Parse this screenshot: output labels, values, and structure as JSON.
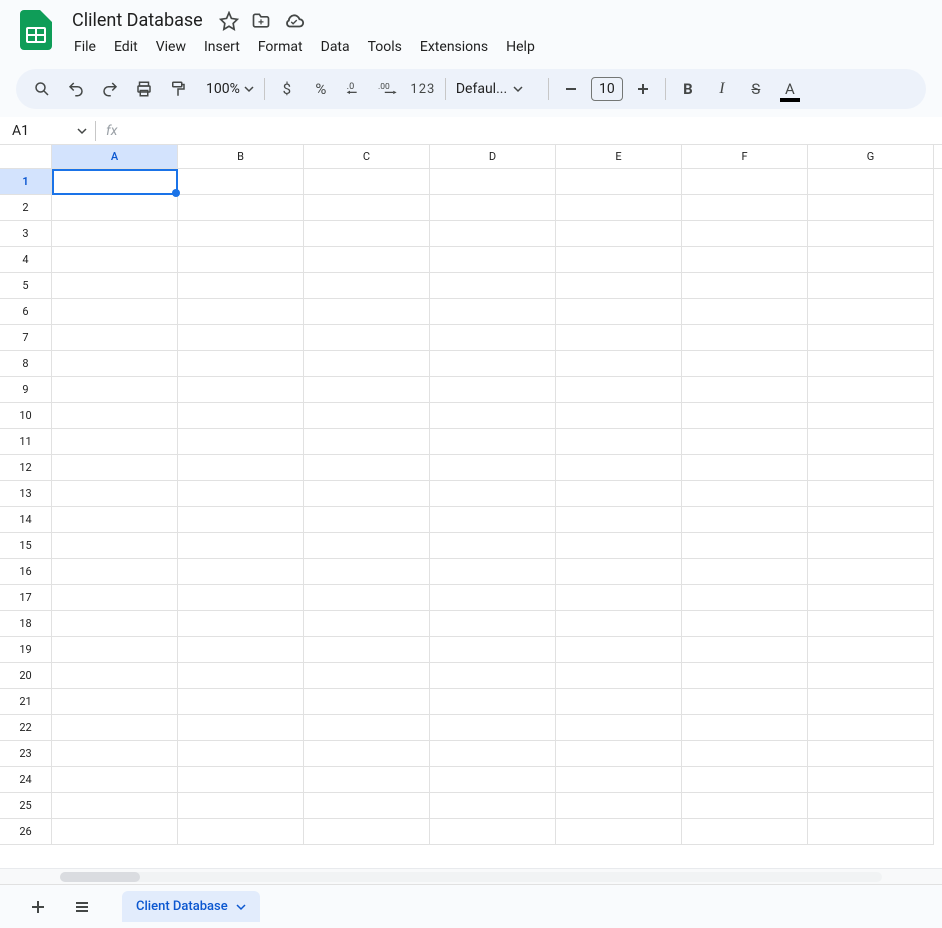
{
  "header": {
    "doc_title": "Clilent Database",
    "menu": [
      "File",
      "Edit",
      "View",
      "Insert",
      "Format",
      "Data",
      "Tools",
      "Extensions",
      "Help"
    ]
  },
  "toolbar": {
    "zoom": "100%",
    "currency": "$",
    "percent": "%",
    "number_format": "123",
    "font_name": "Defaul...",
    "font_size": "10"
  },
  "formula_bar": {
    "cell_ref": "A1",
    "fx_label": "fx",
    "formula": ""
  },
  "grid": {
    "columns": [
      "A",
      "B",
      "C",
      "D",
      "E",
      "F",
      "G"
    ],
    "row_count": 26,
    "selected_col": "A",
    "selected_row": 1
  },
  "tabs": {
    "active": "Client Database"
  }
}
